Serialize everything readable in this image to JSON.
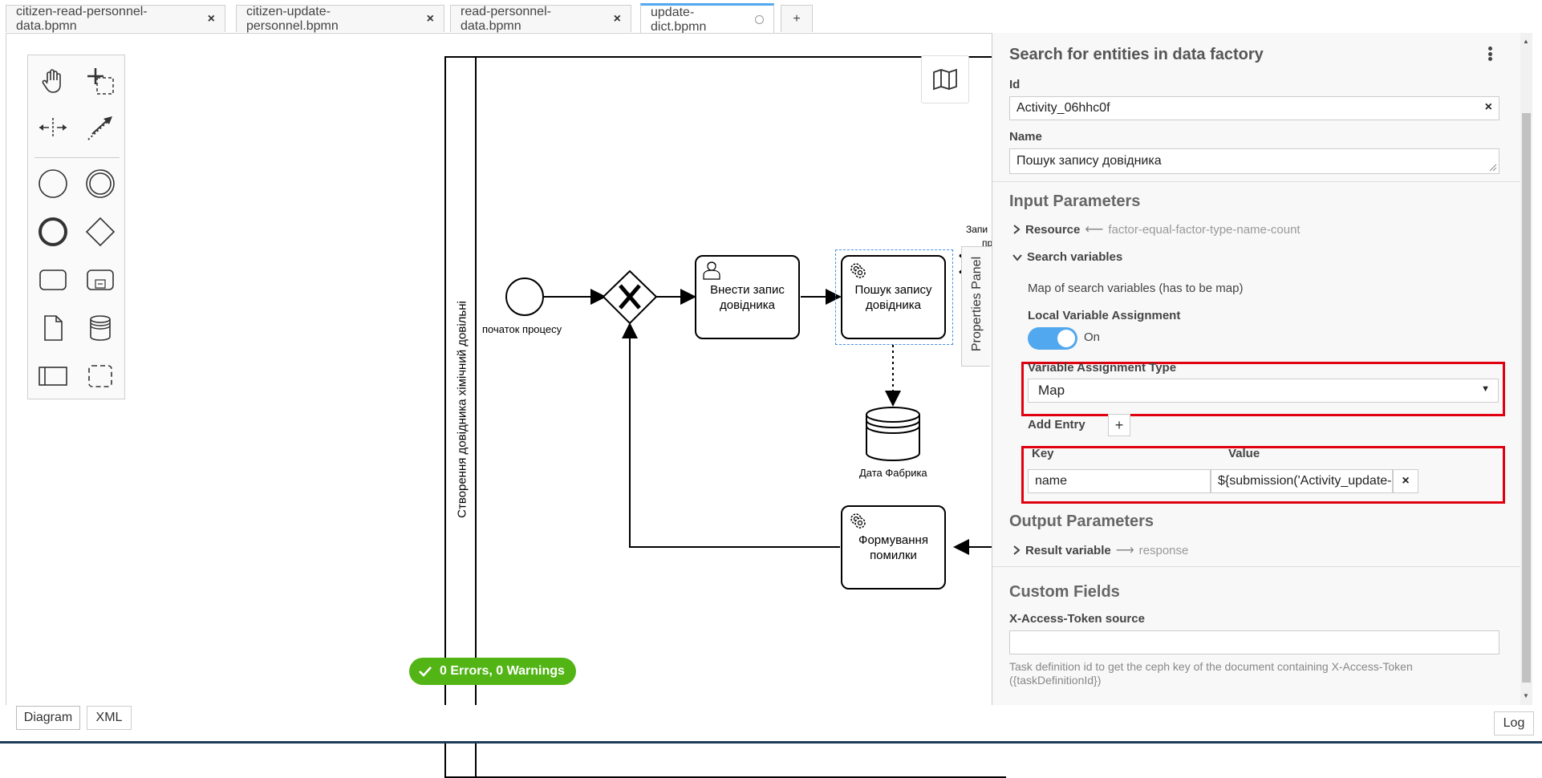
{
  "tabs": [
    {
      "label": "citizen-read-personnel-data.bpmn",
      "close": "×"
    },
    {
      "label": "citizen-update-personnel.bpmn",
      "close": "×"
    },
    {
      "label": "read-personnel-data.bpmn",
      "close": "×"
    },
    {
      "label": "update-dict.bpmn",
      "active": true
    },
    {
      "label": "+"
    }
  ],
  "diagram": {
    "pool_label": "Створення довідника хімічний довільні",
    "start_event_label": "початок процесу",
    "task_add": "Внести запис довідника",
    "task_search": "Пошук запису довідника",
    "task_error": "Формування помилки",
    "datastore_label": "Дата Фабрика",
    "partial_label_1": "Запи",
    "partial_label_2": "пр"
  },
  "validation": {
    "text": "0 Errors, 0 Warnings"
  },
  "properties_toggle": "Properties Panel",
  "panel": {
    "title": "Search for entities in data factory",
    "id_label": "Id",
    "id_value": "Activity_06hhc0f",
    "name_label": "Name",
    "name_value": "Пошук запису довідника",
    "input_params_header": "Input Parameters",
    "resource_label": "Resource",
    "resource_value": "factor-equal-factor-type-name-count",
    "search_vars_label": "Search variables",
    "map_desc": "Map of search variables (has to be map)",
    "local_var_label": "Local Variable Assignment",
    "toggle_state": "On",
    "var_assign_type_label": "Variable Assignment Type",
    "var_assign_type_value": "Map",
    "add_entry_label": "Add Entry",
    "add_entry_btn": "+",
    "key_header": "Key",
    "value_header": "Value",
    "entry_key": "name",
    "entry_value": "${submission('Activity_update-dic",
    "output_params_header": "Output Parameters",
    "result_var_label": "Result variable",
    "result_var_value": "response",
    "custom_fields_header": "Custom Fields",
    "xat_label": "X-Access-Token source",
    "xat_value": "",
    "xat_hint": "Task definition id to get the ceph key of the document containing X-Access-Token ({taskDefinitionId})"
  },
  "bottom": {
    "diagram_tab": "Diagram",
    "xml_tab": "XML",
    "log_btn": "Log"
  },
  "colors": {
    "accent": "#52a8ee",
    "validation_green": "#52b415",
    "highlight_red": "#e00010"
  }
}
